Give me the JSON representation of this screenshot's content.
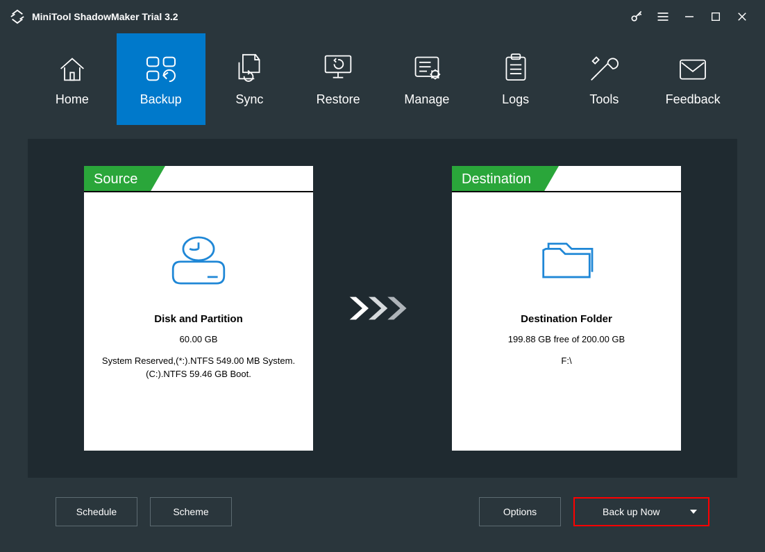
{
  "titlebar": {
    "title": "MiniTool ShadowMaker Trial 3.2"
  },
  "nav": {
    "items": [
      {
        "key": "home",
        "label": "Home"
      },
      {
        "key": "backup",
        "label": "Backup"
      },
      {
        "key": "sync",
        "label": "Sync"
      },
      {
        "key": "restore",
        "label": "Restore"
      },
      {
        "key": "manage",
        "label": "Manage"
      },
      {
        "key": "logs",
        "label": "Logs"
      },
      {
        "key": "tools",
        "label": "Tools"
      },
      {
        "key": "feedback",
        "label": "Feedback"
      }
    ],
    "active": "backup"
  },
  "source": {
    "tab": "Source",
    "title": "Disk and Partition",
    "size": "60.00 GB",
    "details": "System Reserved,(*:).NTFS 549.00 MB System. (C:).NTFS 59.46 GB Boot."
  },
  "destination": {
    "tab": "Destination",
    "title": "Destination Folder",
    "freeline": "199.88 GB free of 200.00 GB",
    "path": "F:\\"
  },
  "buttons": {
    "schedule": "Schedule",
    "scheme": "Scheme",
    "options": "Options",
    "backup_now": "Back up Now"
  },
  "colors": {
    "accent": "#0079cb",
    "green": "#2aa63a",
    "bg": "#2a363c",
    "panel": "#1f2a30",
    "danger_border": "#ff0000",
    "icon_blue": "#1f87d6"
  }
}
